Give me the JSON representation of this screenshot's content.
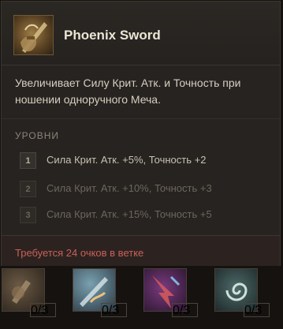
{
  "skill": {
    "title": "Phoenix Sword",
    "description": "Увеличивает Силу Крит. Атк. и Точность при ношении одноручного Меча.",
    "levels_header": "УРОВНИ",
    "levels": [
      {
        "num": "1",
        "text": "Сила Крит. Атк. +5%, Точность +2",
        "active": true
      },
      {
        "num": "2",
        "text": "Сила Крит. Атк. +10%, Точность +3",
        "active": false
      },
      {
        "num": "3",
        "text": "Сила Крит. Атк. +15%, Точность +5",
        "active": false
      }
    ],
    "requirement": "Требуется 24 очков в ветке",
    "icon": "sword-hand-icon"
  },
  "skill_slots": [
    {
      "icon": "hammer-fist-icon",
      "points": "0/3"
    },
    {
      "icon": "fire-slash-icon",
      "points": "0/3"
    },
    {
      "icon": "lightning-strike-icon",
      "points": "0/3"
    },
    {
      "icon": "spiral-wind-icon",
      "points": "0/3"
    }
  ],
  "colors": {
    "background": "#15120f",
    "panel": "#262320",
    "title": "#ece5d6",
    "requirement": "#c9605a"
  }
}
